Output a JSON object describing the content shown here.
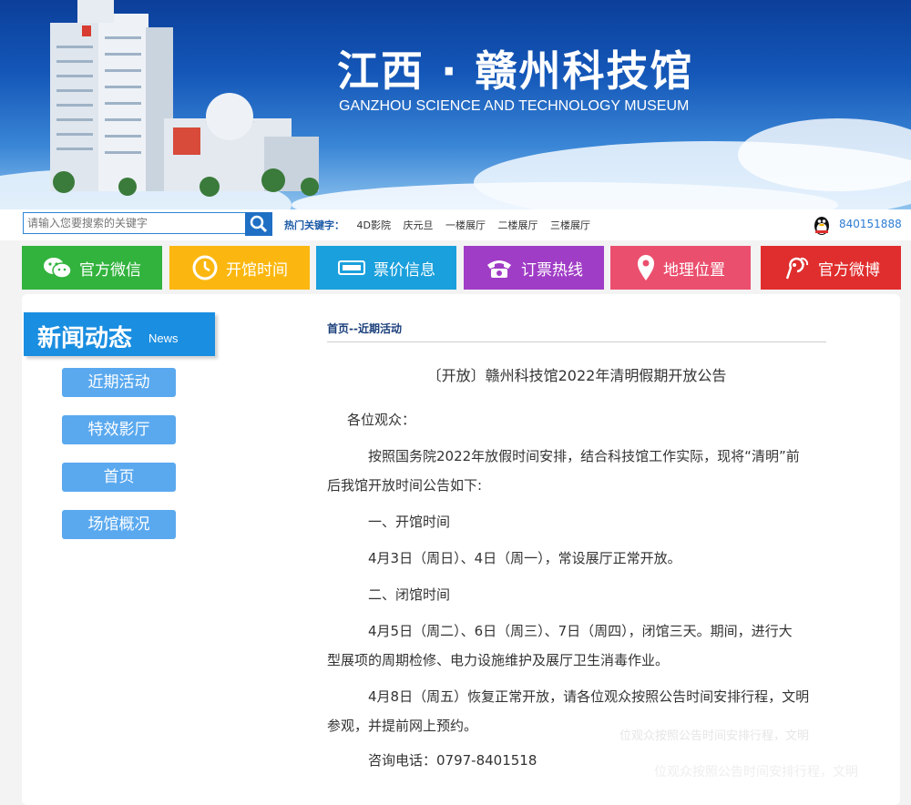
{
  "banner": {
    "title_cn": "江西 · 赣州科技馆",
    "title_en": "GANZHOU SCIENCE AND TECHNOLOGY MUSEUM"
  },
  "search": {
    "placeholder": "请输入您要搜索的关键字",
    "hot_label": "热门关键字：",
    "hot_keywords": [
      "4D影院",
      "庆元旦",
      "一楼展厅",
      "二楼展厅",
      "三楼展厅"
    ]
  },
  "qq": {
    "number": "840151888",
    "icon": "qq-penguin-icon"
  },
  "nav": [
    {
      "label": "官方微信",
      "color": "#32b33d",
      "icon": "wechat-icon"
    },
    {
      "label": "开馆时间",
      "color": "#fbb70f",
      "icon": "clock-icon"
    },
    {
      "label": "票价信息",
      "color": "#1aa0dc",
      "icon": "ticket-icon"
    },
    {
      "label": "订票热线",
      "color": "#a03dc6",
      "icon": "phone-icon"
    },
    {
      "label": "地理位置",
      "color": "#eb4f6e",
      "icon": "location-pin-icon"
    },
    {
      "label": "官方微博",
      "color": "#e02d2d",
      "icon": "weibo-icon"
    }
  ],
  "sidebar": {
    "title": "新闻动态",
    "title_en": "News",
    "items": [
      "近期活动",
      "特效影厅",
      "首页",
      "场馆概况"
    ]
  },
  "article": {
    "breadcrumb": "首页--近期活动",
    "title": "〔开放〕赣州科技馆2022年清明假期开放公告",
    "greeting": "各位观众：",
    "p1_line1": "按照国务院2022年放假时间安排，结合科技馆工作实际，现将“清明”前",
    "p1_line2": "后我馆开放时间公告如下:",
    "h1": "一、开馆时间",
    "p2": "4月3日（周日）、4日（周一），常设展厅正常开放。",
    "h2": "二、闭馆时间",
    "p3_line1": "4月5日（周二）、6日（周三）、7日（周四），闭馆三天。期间，进行大",
    "p3_line2": "型展项的周期检修、电力设施维护及展厅卫生消毒作业。",
    "p4_line1": "4月8日（周五）恢复正常开放，请各位观众按照公告时间安排行程，文明",
    "p4_line2": "参观，并提前网上预约。",
    "contact": "咨询电话：0797-8401518"
  },
  "watermark": {
    "line1": "位观众按照公告时间安排行程，文明",
    "line2": "位观众按照公告时间安排行程，文明"
  }
}
